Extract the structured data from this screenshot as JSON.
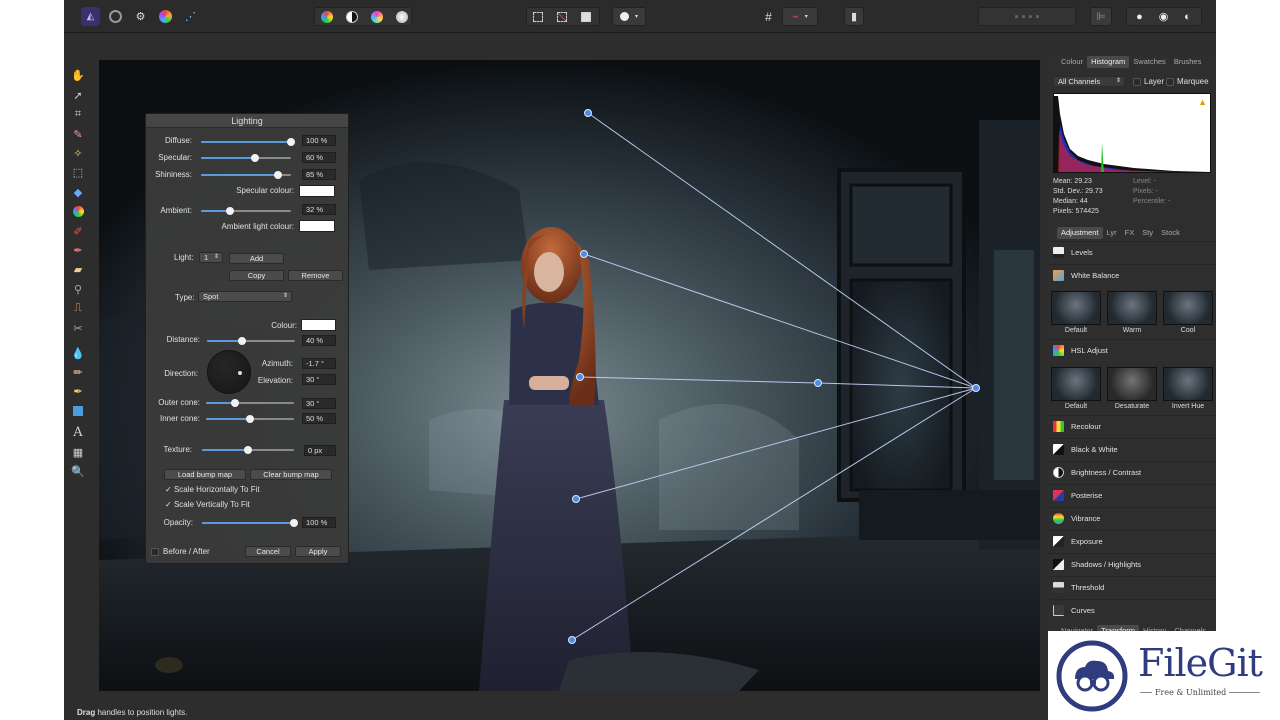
{
  "toolbar": {
    "left_icons": [
      "affinity-photo-icon",
      "persona-liquify-icon",
      "persona-develop-icon",
      "persona-tone-icon",
      "persona-export-icon"
    ],
    "adjust_icons": [
      "auto-levels-icon",
      "auto-contrast-icon",
      "auto-colours-icon",
      "auto-white-balance-icon"
    ],
    "selection_icons": [
      "marquee-icon",
      "deselect-icon",
      "invert-selection-icon",
      "quick-mask-icon"
    ],
    "snap_icons": [
      "grid-icon",
      "snapping-icon"
    ]
  },
  "status": {
    "bold": "Drag",
    "rest": " handles to position lights."
  },
  "lighting": {
    "title": "Lighting",
    "diffuse": {
      "label": "Diffuse:",
      "value": "100 %",
      "level": 1.0
    },
    "specular": {
      "label": "Specular:",
      "value": "60 %",
      "level": 0.6
    },
    "shininess": {
      "label": "Shininess:",
      "value": "85 %",
      "level": 0.85
    },
    "specular_colour": {
      "label": "Specular colour:",
      "color": "#ffffff"
    },
    "ambient": {
      "label": "Ambient:",
      "value": "32 %",
      "level": 0.32
    },
    "ambient_light_colour": {
      "label": "Ambient light colour:",
      "color": "#ffffff"
    },
    "light": {
      "label": "Light:",
      "value": "1",
      "add": "Add",
      "copy": "Copy",
      "remove": "Remove"
    },
    "type": {
      "label": "Type:",
      "value": "Spot"
    },
    "colour": {
      "label": "Colour:",
      "color": "#ffffff"
    },
    "distance": {
      "label": "Distance:",
      "value": "40 %",
      "level": 0.4
    },
    "direction": {
      "label": "Direction:",
      "azimuth_label": "Azimuth:",
      "azimuth": "-1.7 °",
      "elevation_label": "Elevation:",
      "elevation": "30 °"
    },
    "outer_cone": {
      "label": "Outer cone:",
      "value": "30 °",
      "level": 0.33
    },
    "inner_cone": {
      "label": "Inner cone:",
      "value": "50 %",
      "level": 0.5
    },
    "texture": {
      "label": "Texture:",
      "value": "0 px",
      "level": 0.5
    },
    "load_bump": "Load bump map",
    "clear_bump": "Clear bump map",
    "scale_h": "Scale Horizontally To Fit",
    "scale_v": "Scale Vertically To Fit",
    "opacity": {
      "label": "Opacity:",
      "value": "100 %",
      "level": 1.0
    },
    "before_after": "Before / After",
    "cancel": "Cancel",
    "apply": "Apply"
  },
  "right_panel": {
    "top_tabs": [
      "Colour",
      "Histogram",
      "Swatches",
      "Brushes"
    ],
    "channels": "All Channels",
    "layer_label": "Layer",
    "marquee_label": "Marquee",
    "stats_left": [
      "Mean: 29.23",
      "Std. Dev.: 29.73",
      "Median: 44",
      "Pixels: 574425"
    ],
    "stats_right": [
      "Level: -",
      "Pixels: -",
      "Percentile: -"
    ],
    "adj_tabs": [
      "Adjustment",
      "Lyr",
      "FX",
      "Sty",
      "Stock"
    ],
    "levels": "Levels",
    "white_balance": "White Balance",
    "wb_presets": [
      "Default",
      "Warm",
      "Cool"
    ],
    "hsl": "HSL Adjust",
    "hsl_presets": [
      "Default",
      "Desaturate",
      "Invert Hue"
    ],
    "adjustments": [
      "Recolour",
      "Black & White",
      "Brightness / Contrast",
      "Posterise",
      "Vibrance",
      "Exposure",
      "Shadows / Highlights",
      "Threshold",
      "Curves"
    ],
    "bottom_tabs": [
      "Navigator",
      "Transform",
      "History",
      "Channels"
    ]
  },
  "watermark": {
    "title": "FileGit",
    "subtitle": "Free & Unlimited"
  }
}
